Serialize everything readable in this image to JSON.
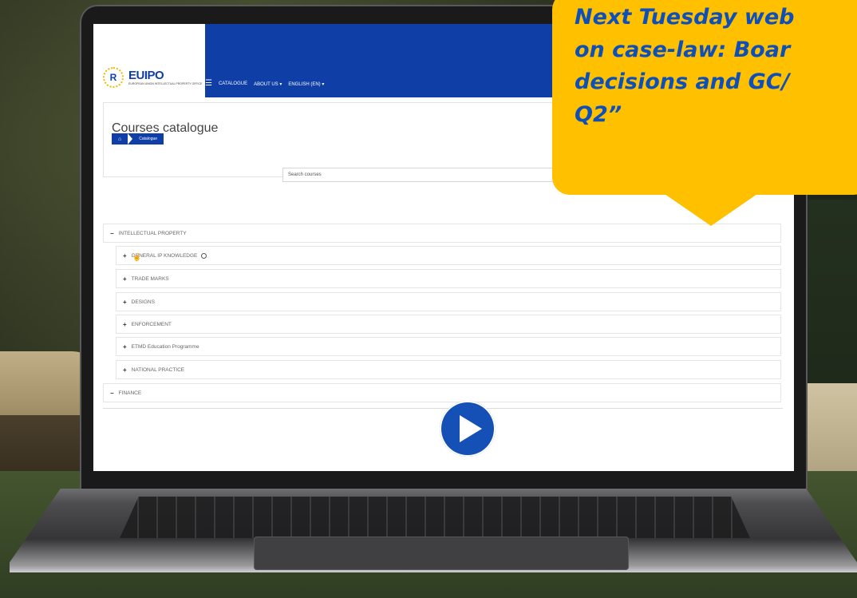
{
  "callout": {
    "text": "Next Tuesday web\non case-law: Boar\ndecisions and GC/\nQ2”"
  },
  "lms": {
    "brand": {
      "logo_mark": "R",
      "name": "EUIPO",
      "subtitle": "EUROPEAN UNION INTELLECTUAL PROPERTY OFFICE"
    },
    "nav": {
      "menu_icon": "hamburger-icon",
      "items": [
        "CATALOGUE",
        "ABOUT US ▾",
        "ENGLISH (EN) ▾"
      ]
    },
    "page_title": "Courses catalogue",
    "breadcrumb": {
      "home_icon": "home-icon",
      "current": "Catalogue"
    },
    "search": {
      "placeholder": "Search courses"
    },
    "categories": [
      {
        "sign": "−",
        "label": "INTELLECTUAL PROPERTY"
      },
      {
        "sign": "+",
        "label": "GENERAL IP KNOWLEDGE"
      },
      {
        "sign": "+",
        "label": "TRADE MARKS"
      },
      {
        "sign": "+",
        "label": "DESIGNS"
      },
      {
        "sign": "+",
        "label": "ENFORCEMENT"
      },
      {
        "sign": "+",
        "label": "ETMD Education Programme"
      },
      {
        "sign": "+",
        "label": "NATIONAL PRACTICE"
      },
      {
        "sign": "−",
        "label": "FINANCE"
      }
    ]
  },
  "video": {
    "play_icon": "play-icon"
  },
  "colors": {
    "brand_blue": "#0f3fa6",
    "callout_yellow": "#ffc000",
    "callout_text": "#0f4fb8",
    "play_button": "#1450b5"
  }
}
